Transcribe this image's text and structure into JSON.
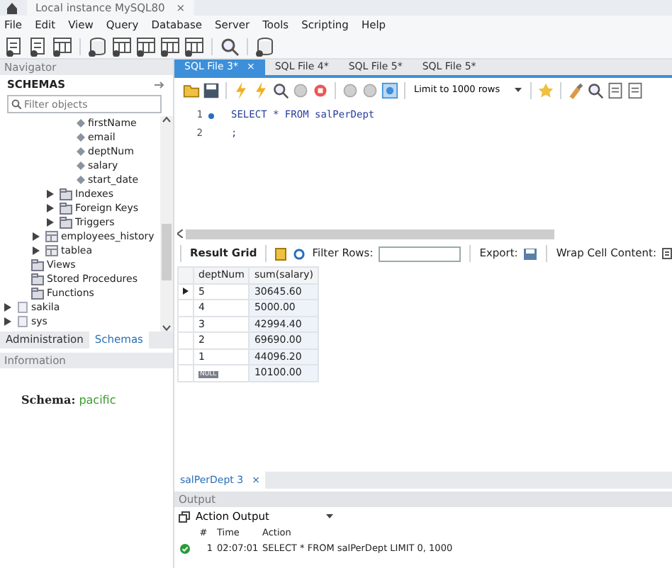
{
  "window": {
    "title": "Local instance MySQL80",
    "close": "×"
  },
  "menu": [
    "File",
    "Edit",
    "View",
    "Query",
    "Database",
    "Server",
    "Tools",
    "Scripting",
    "Help"
  ],
  "navigator": {
    "title": "Navigator",
    "section": "SCHEMAS",
    "filter": {
      "placeholder": "Filter objects"
    },
    "tree": [
      {
        "children": [
          {
            "children": [
              {
                "children": [
                  {
                    "children": [
                      {
                        "kind": "column",
                        "label": "firstName"
                      },
                      {
                        "kind": "column",
                        "label": "email"
                      },
                      {
                        "kind": "column",
                        "label": "deptNum"
                      },
                      {
                        "kind": "column",
                        "label": "salary"
                      },
                      {
                        "kind": "column",
                        "label": "start_date"
                      }
                    ]
                  },
                  {
                    "kind": "folder",
                    "label": "Indexes",
                    "expanded": false
                  },
                  {
                    "kind": "folder",
                    "label": "Foreign Keys",
                    "expanded": false
                  },
                  {
                    "kind": "folder",
                    "label": "Triggers",
                    "expanded": false
                  }
                ]
              },
              {
                "kind": "table",
                "label": "employees_history",
                "expanded": false
              },
              {
                "kind": "table",
                "label": "tablea",
                "expanded": false
              }
            ]
          },
          {
            "kind": "folder",
            "label": "Views"
          },
          {
            "kind": "folder",
            "label": "Stored Procedures"
          },
          {
            "kind": "folder",
            "label": "Functions"
          }
        ]
      },
      {
        "kind": "schema",
        "label": "sakila",
        "expanded": false
      },
      {
        "kind": "schema",
        "label": "sys",
        "expanded": false
      }
    ],
    "tabs": [
      {
        "label": "Administration",
        "selected": false
      },
      {
        "label": "Schemas",
        "selected": true
      }
    ],
    "info_title": "Information",
    "schema_label": "Schema:",
    "schema_value": "pacific"
  },
  "editor_tabs": [
    {
      "label": "SQL File 3*",
      "selected": true,
      "close": "×"
    },
    {
      "label": "SQL File 4*",
      "selected": false
    },
    {
      "label": "SQL File 5*",
      "selected": false
    },
    {
      "label": "SQL File 5*",
      "selected": false
    }
  ],
  "limit": "Limit to 1000 rows",
  "editor_lines": [
    {
      "number": "1",
      "marker": true,
      "code": "SELECT * FROM salPerDept"
    },
    {
      "number": "2",
      "marker": false,
      "code": ";"
    }
  ],
  "results": {
    "view": "Result Grid",
    "filter_label": "Filter Rows:",
    "export_label": "Export:",
    "wrap_label": "Wrap Cell Content:",
    "columns": [
      "deptNum",
      "sum(salary)"
    ],
    "rows": [
      {
        "current": true,
        "cells": [
          {
            "text": "5"
          },
          {
            "text": "30645.60"
          }
        ]
      },
      {
        "current": false,
        "cells": [
          {
            "text": "4"
          },
          {
            "text": "5000.00"
          }
        ]
      },
      {
        "current": false,
        "cells": [
          {
            "text": "3"
          },
          {
            "text": "42994.40"
          }
        ]
      },
      {
        "current": false,
        "cells": [
          {
            "text": "2"
          },
          {
            "text": "69690.00"
          }
        ]
      },
      {
        "current": false,
        "cells": [
          {
            "text": "1"
          },
          {
            "text": "44096.20"
          }
        ]
      },
      {
        "current": false,
        "cells": [
          {
            "text": "NULL",
            "kind": "null"
          },
          {
            "text": "10100.00"
          }
        ]
      }
    ],
    "tab": {
      "label": "salPerDept 3",
      "close": "×"
    }
  },
  "output": {
    "title": "Output",
    "mode": "Action Output",
    "columns": [
      "#",
      "Time",
      "Action"
    ],
    "rows": [
      {
        "succeeded": true,
        "number": "1",
        "time": "02:07:01",
        "action": "SELECT * FROM salPerDept LIMIT 0, 1000"
      }
    ]
  }
}
